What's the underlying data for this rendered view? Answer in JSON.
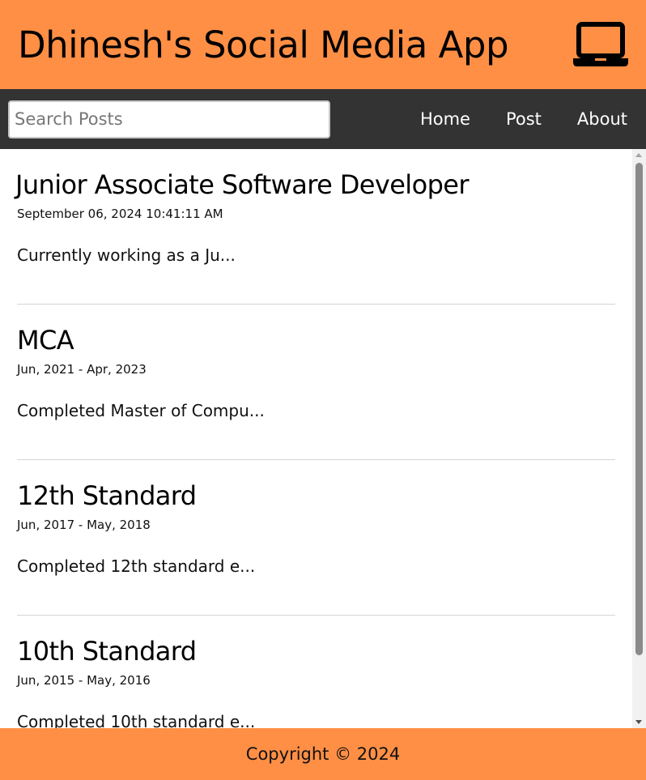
{
  "header": {
    "title": "Dhinesh's Social Media App",
    "icon": "laptop-icon"
  },
  "nav": {
    "search_placeholder": "Search Posts",
    "search_value": "",
    "links": [
      {
        "label": "Home"
      },
      {
        "label": "Post"
      },
      {
        "label": "About"
      }
    ]
  },
  "posts": [
    {
      "title": "Junior Associate Software Developer",
      "date": "September 06, 2024 10:41:11 AM",
      "body": "Currently working as a Ju..."
    },
    {
      "title": "MCA",
      "date": "Jun, 2021 - Apr, 2023",
      "body": "Completed Master of Compu..."
    },
    {
      "title": "12th Standard",
      "date": "Jun, 2017 - May, 2018",
      "body": "Completed 12th standard e..."
    },
    {
      "title": "10th Standard",
      "date": "Jun, 2015 - May, 2016",
      "body": "Completed 10th standard e..."
    }
  ],
  "footer": {
    "copyright": "Copyright © 2024"
  },
  "colors": {
    "brand": "#ff8f45",
    "navbar": "#333333",
    "divider": "#d4d4d4"
  }
}
